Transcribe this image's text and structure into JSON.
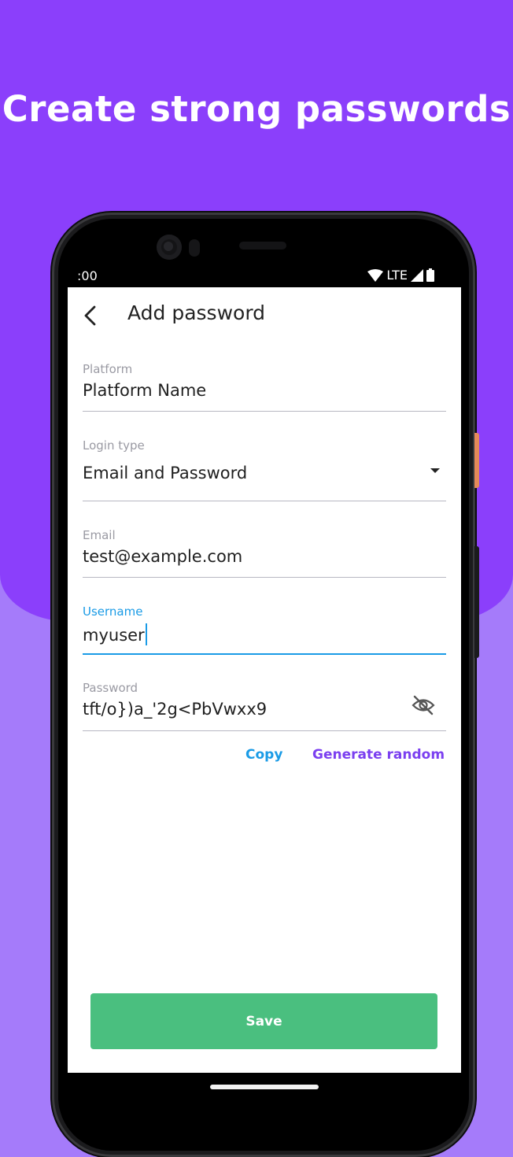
{
  "headline": "Create strong passwords",
  "status_bar": {
    "time": ":00",
    "network": "LTE"
  },
  "header": {
    "title": "Add password",
    "back_icon": "chevron-left-icon"
  },
  "form": {
    "platform": {
      "label": "Platform",
      "value": "Platform Name"
    },
    "login_type": {
      "label": "Login type",
      "value": "Email and Password",
      "icon": "dropdown-arrow-icon"
    },
    "email": {
      "label": "Email",
      "value": "test@example.com"
    },
    "username": {
      "label": "Username",
      "value": "myuser",
      "focused": true
    },
    "password": {
      "label": "Password",
      "value": "tft/o})a_'2g<PbVwxx9",
      "icon": "eye-off-icon"
    }
  },
  "actions": {
    "copy": "Copy",
    "generate": "Generate random"
  },
  "save_label": "Save",
  "colors": {
    "background_top": "#8b3ffb",
    "background_bottom": "#a57bfa",
    "accent_blue": "#1a9be6",
    "accent_purple": "#7b3ff0",
    "save_green": "#4abf7f"
  }
}
